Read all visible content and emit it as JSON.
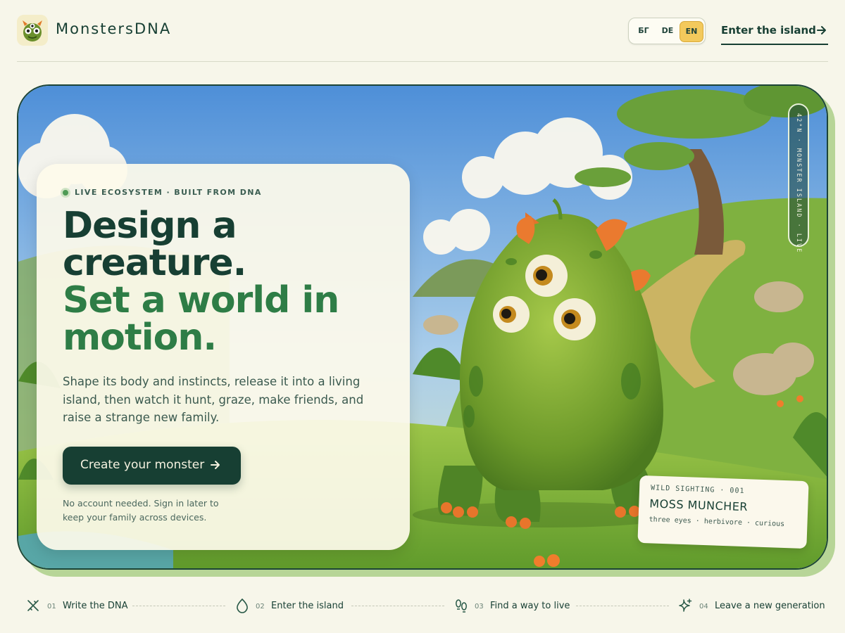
{
  "header": {
    "brand": "MonstersDNA",
    "languages": [
      "БГ",
      "DE",
      "EN"
    ],
    "active_language": "EN",
    "enter_link": "Enter the island"
  },
  "hero": {
    "eyebrow": "LIVE ECOSYSTEM · BUILT FROM DNA",
    "headline_line1": "Design a",
    "headline_line2": "creature.",
    "headline_line3": "Set a world in",
    "headline_line4": "motion.",
    "lede": "Shape its body and instincts, release it into a living island, then watch it hunt, graze, make friends, and raise a strange new family.",
    "cta_label": "Create your monster",
    "note": "No account needed. Sign in later to keep your family across devices.",
    "vertical_tag": "42°N · MONSTER ISLAND · LIVE"
  },
  "sighting": {
    "kicker": "WILD SIGHTING · 001",
    "name": "MOSS MUNCHER",
    "desc": "three eyes · herbivore · curious"
  },
  "steps": [
    {
      "num": "01",
      "label": "Write the DNA",
      "icon": "dna-icon"
    },
    {
      "num": "02",
      "label": "Enter the island",
      "icon": "egg-icon"
    },
    {
      "num": "03",
      "label": "Find a way to live",
      "icon": "footprints-icon"
    },
    {
      "num": "04",
      "label": "Leave a new generation",
      "icon": "sparkles-icon"
    }
  ],
  "colors": {
    "background": "#f7f6ea",
    "primary": "#173f33",
    "accent_green": "#2e7d46",
    "accent_yellow": "#f3c95c",
    "hero_shadow": "#b7d597"
  }
}
